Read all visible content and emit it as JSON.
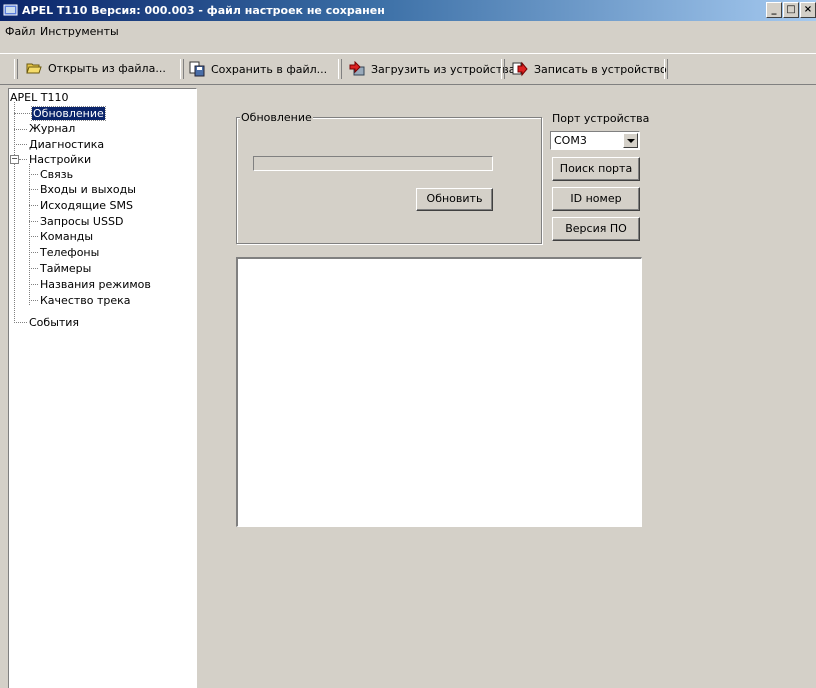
{
  "window": {
    "title": "APEL T110   Версия: 000.003 - файл настроек не сохранен",
    "buttons": {
      "minimize": "_",
      "maximize": "□",
      "close": "×"
    }
  },
  "menu": {
    "items": [
      "Файл",
      "Инструменты"
    ]
  },
  "toolbar": {
    "open_label": "Открыть из файла...",
    "save_label": "Сохранить в файл...",
    "load_label": "Загрузить из устройства",
    "write_label": "Записать в устройство"
  },
  "tree": {
    "root": "APEL T110",
    "items": {
      "update": "Обновление",
      "journal": "Журнал",
      "diagnostics": "Диагностика",
      "settings": "Настройки",
      "connection": "Связь",
      "io": "Входы и выходы",
      "sms": "Исходящие SMS",
      "ussd": "Запросы USSD",
      "commands": "Команды",
      "phones": "Телефоны",
      "timers": "Таймеры",
      "mode_names": "Названия режимов",
      "track_quality": "Качество трека",
      "events": "События"
    },
    "selected": "Обновление",
    "settings_expanded": true
  },
  "update_panel": {
    "group_title": "Обновление",
    "progress": 0,
    "update_button": "Обновить"
  },
  "port": {
    "label": "Порт устройства",
    "value": "COM3",
    "search_button": "Поиск порта",
    "id_button": "ID номер",
    "version_button": "Версия ПО"
  },
  "colors": {
    "title_bar": "#0a246a",
    "selection": "#0a246a",
    "face": "#d4d0c8"
  }
}
